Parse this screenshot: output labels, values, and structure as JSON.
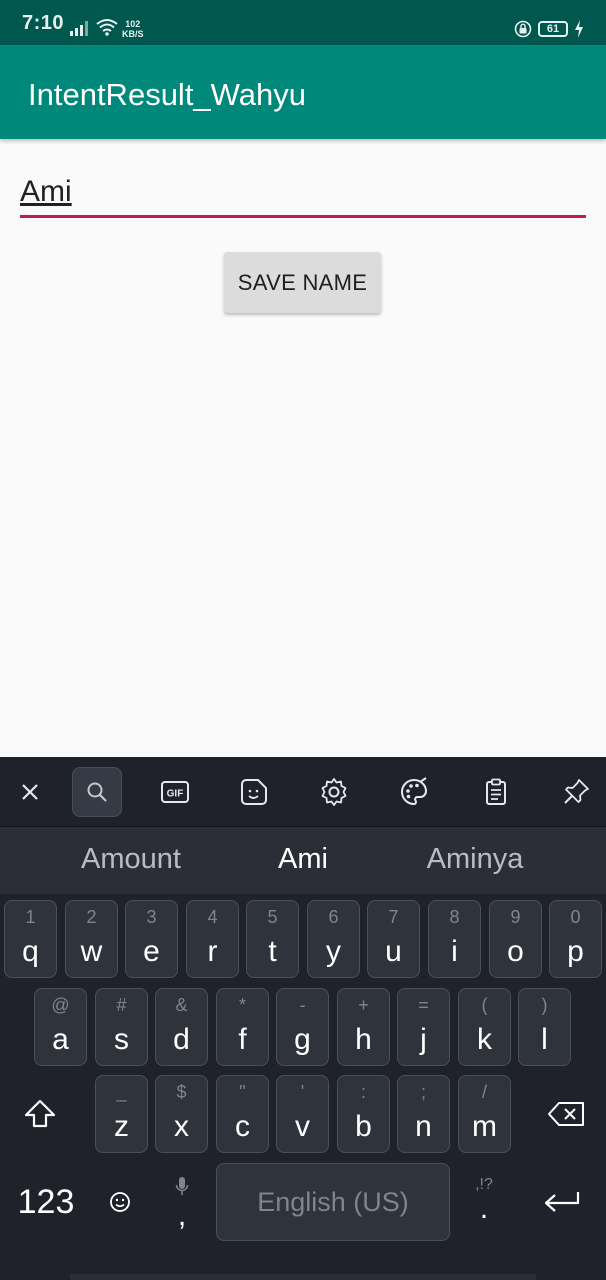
{
  "status_bar": {
    "time": "7:10",
    "net_speed_value": "102",
    "net_speed_unit": "KB/S",
    "battery": "61"
  },
  "app_bar": {
    "title": "IntentResult_Wahyu"
  },
  "form": {
    "name_value": "Ami",
    "save_button_label": "SAVE NAME"
  },
  "keyboard": {
    "suggestions": [
      "Amount",
      "Ami",
      "Aminya"
    ],
    "row1": [
      {
        "hint": "1",
        "key": "q"
      },
      {
        "hint": "2",
        "key": "w"
      },
      {
        "hint": "3",
        "key": "e"
      },
      {
        "hint": "4",
        "key": "r"
      },
      {
        "hint": "5",
        "key": "t"
      },
      {
        "hint": "6",
        "key": "y"
      },
      {
        "hint": "7",
        "key": "u"
      },
      {
        "hint": "8",
        "key": "i"
      },
      {
        "hint": "9",
        "key": "o"
      },
      {
        "hint": "0",
        "key": "p"
      }
    ],
    "row2": [
      {
        "hint": "@",
        "key": "a"
      },
      {
        "hint": "#",
        "key": "s"
      },
      {
        "hint": "&",
        "key": "d"
      },
      {
        "hint": "*",
        "key": "f"
      },
      {
        "hint": "-",
        "key": "g"
      },
      {
        "hint": "+",
        "key": "h"
      },
      {
        "hint": "=",
        "key": "j"
      },
      {
        "hint": "(",
        "key": "k"
      },
      {
        "hint": ")",
        "key": "l"
      }
    ],
    "row3": [
      {
        "hint": "_",
        "key": "z"
      },
      {
        "hint": "$",
        "key": "x"
      },
      {
        "hint": "\"",
        "key": "c"
      },
      {
        "hint": "'",
        "key": "v"
      },
      {
        "hint": ":",
        "key": "b"
      },
      {
        "hint": ";",
        "key": "n"
      },
      {
        "hint": "/",
        "key": "m"
      }
    ],
    "numbers_key": "123",
    "comma_key": ",",
    "space_label": "English (US)",
    "period_hint": ",!?",
    "period_key": "."
  },
  "colors": {
    "status_bar": "#00574e",
    "app_bar": "#00897b",
    "input_underline": "#c2185b",
    "keyboard_bg": "#1f222a"
  }
}
